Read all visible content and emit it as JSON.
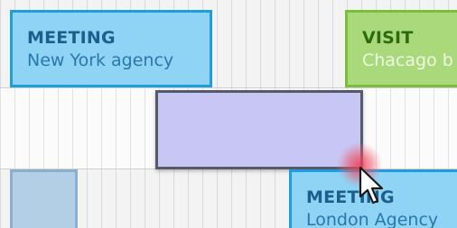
{
  "events": {
    "meeting_ny": {
      "title": "MEETING",
      "subtitle": "New York agency"
    },
    "visit": {
      "title": "VISIT",
      "subtitle": "Chacago b"
    },
    "meeting_london": {
      "title": "MEETING",
      "subtitle": "London Agency"
    }
  },
  "colors": {
    "meeting_fill": "#8fd3f5",
    "meeting_border": "#1e9ee0",
    "visit_fill": "#a9d97a",
    "drag_fill": "#c8c6f5",
    "click_indicator": "#f03c50"
  },
  "icons": {
    "cursor": "arrow-pointer-icon",
    "click": "click-indicator"
  }
}
